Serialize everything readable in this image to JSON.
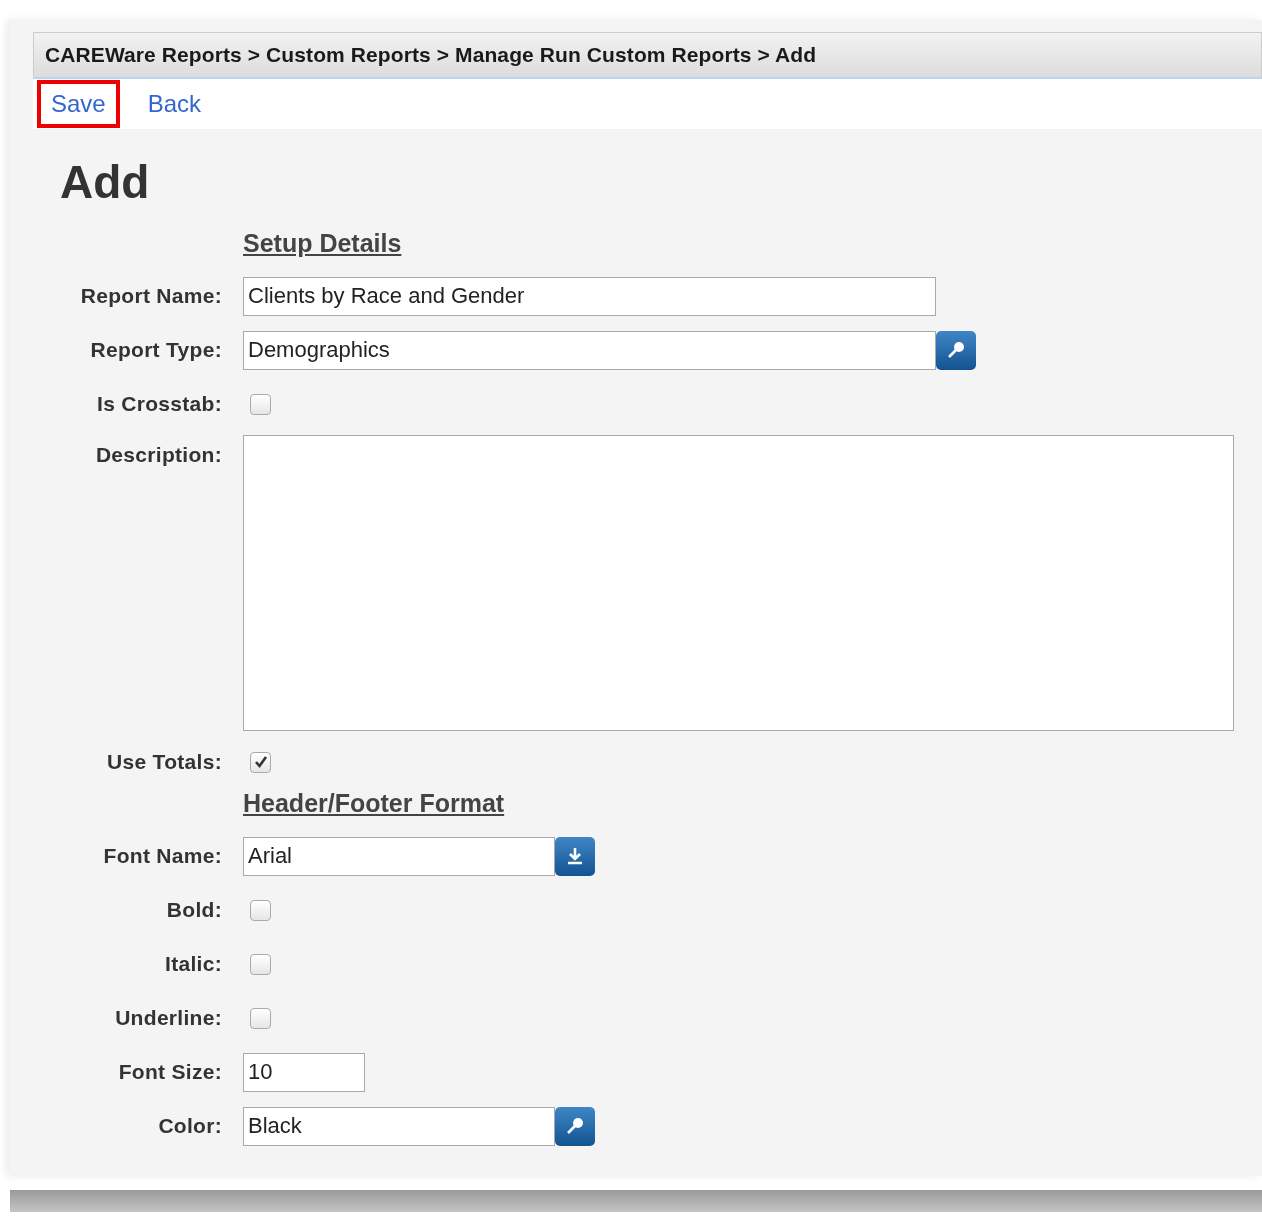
{
  "breadcrumb": "CAREWare Reports > Custom Reports > Manage Run Custom Reports > Add",
  "actions": [
    {
      "label": "Save",
      "highlighted": true
    },
    {
      "label": "Back",
      "highlighted": false
    }
  ],
  "title": "Add",
  "sections": [
    {
      "heading": "Setup Details",
      "fields": [
        {
          "kind": "text",
          "label": "Report Name:",
          "value": "Clients by Race and Gender"
        },
        {
          "kind": "lookup",
          "label": "Report Type:",
          "value": "Demographics"
        },
        {
          "kind": "checkbox",
          "label": "Is Crosstab:",
          "checked": false
        },
        {
          "kind": "textarea",
          "label": "Description:"
        },
        {
          "kind": "checkbox",
          "label": "Use Totals:",
          "checked": true
        }
      ]
    },
    {
      "heading": "Header/Footer Format",
      "fields": [
        {
          "kind": "select",
          "label": "Font Name:",
          "value": "Arial"
        },
        {
          "kind": "checkbox",
          "label": "Bold:",
          "checked": false
        },
        {
          "kind": "checkbox",
          "label": "Italic:",
          "checked": false
        },
        {
          "kind": "checkbox",
          "label": "Underline:",
          "checked": false
        },
        {
          "kind": "number",
          "label": "Font Size:",
          "value": "10"
        },
        {
          "kind": "lookup",
          "label": "Color:",
          "value": "Black"
        }
      ]
    }
  ]
}
